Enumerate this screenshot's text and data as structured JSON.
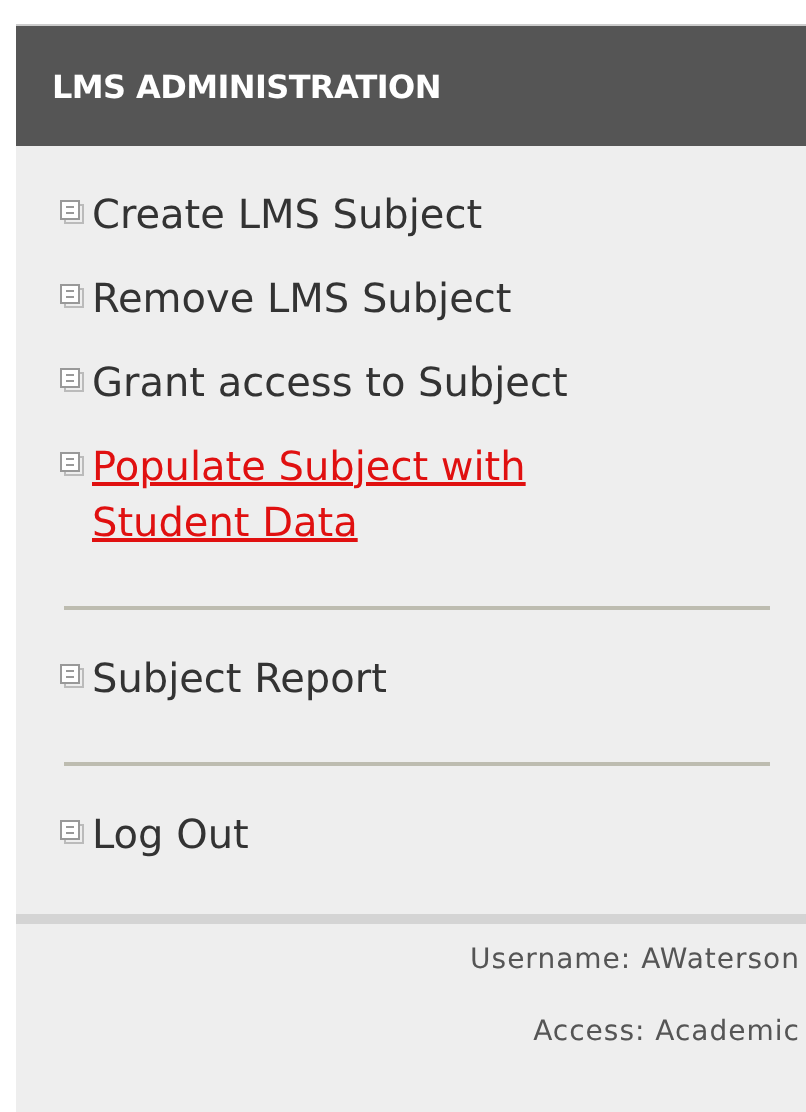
{
  "header": {
    "title": "LMS ADMINISTRATION"
  },
  "menu": {
    "groups": [
      {
        "items": [
          {
            "label": "Create LMS Subject",
            "selected": false
          },
          {
            "label": "Remove LMS Subject",
            "selected": false
          },
          {
            "label": "Grant access to Subject",
            "selected": false
          },
          {
            "label": "Populate Subject with Student Data",
            "selected": true
          }
        ]
      },
      {
        "items": [
          {
            "label": "Subject Report",
            "selected": false
          }
        ]
      },
      {
        "items": [
          {
            "label": "Log Out",
            "selected": false
          }
        ]
      }
    ]
  },
  "footer": {
    "lines": [
      "Username: AWaterson",
      "Access: Academic"
    ]
  }
}
